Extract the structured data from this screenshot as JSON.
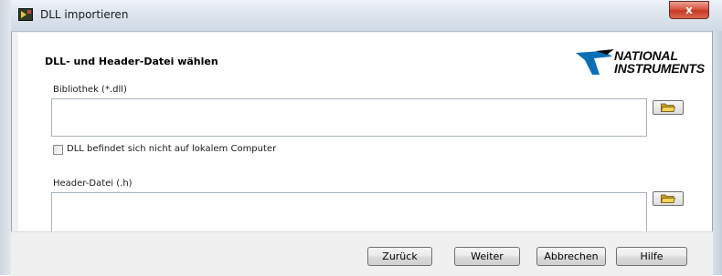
{
  "window": {
    "title": "DLL importieren",
    "close_label": "x"
  },
  "page": {
    "heading": "DLL- und Header-Datei wählen",
    "logo": {
      "line1": "NATIONAL",
      "line2": "INSTRUMENTS"
    }
  },
  "library": {
    "label": "Bibliothek (*.dll)",
    "value": "",
    "browse_icon": "folder-open-icon"
  },
  "remote_checkbox": {
    "label": "DLL befindet sich nicht auf lokalem Computer",
    "checked": false
  },
  "header_file": {
    "label": "Header-Datei (.h)",
    "value": "",
    "browse_icon": "folder-open-icon"
  },
  "buttons": {
    "back": "Zurück",
    "next": "Weiter",
    "cancel": "Abbrechen",
    "help": "Hilfe"
  },
  "colors": {
    "close_button": "#c63a25",
    "folder_icon": "#e8c23a",
    "logo_accent": "#0b6fb6"
  }
}
